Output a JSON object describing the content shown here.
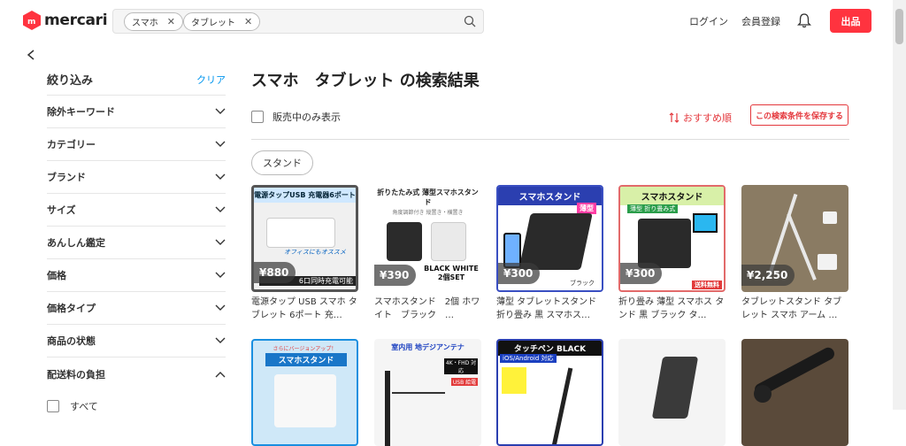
{
  "header": {
    "logo_text": "mercari",
    "search_chips": [
      "スマホ",
      "タブレット"
    ],
    "login": "ログイン",
    "register": "会員登録",
    "sell": "出品"
  },
  "sidebar": {
    "title": "絞り込み",
    "clear": "クリア",
    "items": [
      "除外キーワード",
      "カテゴリー",
      "ブランド",
      "サイズ",
      "あんしん鑑定",
      "価格",
      "価格タイプ",
      "商品の状態",
      "配送料の負担"
    ],
    "all_label": "すべて"
  },
  "main": {
    "title": "スマホ　タブレット の検索結果",
    "on_sale_label": "販売中のみ表示",
    "sort_label": "おすすめ順",
    "save_label": "この検索条件を保存する",
    "tag": "スタンド"
  },
  "products": [
    {
      "price": "¥880",
      "name": "電源タップ USB スマホ タブレット 6ポート 充…",
      "thumb_text": "電源タップUSB 充電器6ポート",
      "thumb_sub": "オフィスにもオススメ",
      "thumb_foot": "6口同時充電可能"
    },
    {
      "price": "¥390",
      "name": "スマホスタンド　2個 ホワイト　ブラック　…",
      "thumb_text": "折りたたみ式 薄型スマホスタンド",
      "thumb_sub": "角度調節付き 縦置き・横置き",
      "thumb_foot": "BLACK WHITE 2個SET"
    },
    {
      "price": "¥300",
      "name": "薄型 タブレットスタンド 折り畳み 黒 スマホス…",
      "thumb_text": "スマホスタンド",
      "thumb_sub": "薄型",
      "thumb_foot": "ブラック"
    },
    {
      "price": "¥300",
      "name": "折り畳み 薄型 スマホス タンド 黒 ブラック タ…",
      "thumb_text": "スマホスタンド",
      "thumb_sub": "薄型 折り畳み式",
      "thumb_foot": "送料無料"
    },
    {
      "price": "¥2,250",
      "name": "タブレットスタンド タブ レット スマホ アーム …",
      "thumb_text": "",
      "thumb_sub": "",
      "thumb_foot": ""
    },
    {
      "price": "",
      "name": "",
      "thumb_text": "スマホスタンド",
      "thumb_sub": "さらにバージョンアップ！",
      "thumb_foot": ""
    },
    {
      "price": "",
      "name": "",
      "thumb_text": "室内用 地デジアンテナ",
      "thumb_sub": "4K・FHD 対応",
      "thumb_foot": "USB 給電"
    },
    {
      "price": "",
      "name": "",
      "thumb_text": "タッチペン BLACK",
      "thumb_sub": "iOS/Android 対応",
      "thumb_foot": ""
    },
    {
      "price": "",
      "name": "",
      "thumb_text": "",
      "thumb_sub": "",
      "thumb_foot": ""
    },
    {
      "price": "",
      "name": "",
      "thumb_text": "",
      "thumb_sub": "",
      "thumb_foot": ""
    }
  ],
  "colors": {
    "accent": "#ff333f",
    "link": "#0095ee",
    "sort": "#e4383d"
  }
}
